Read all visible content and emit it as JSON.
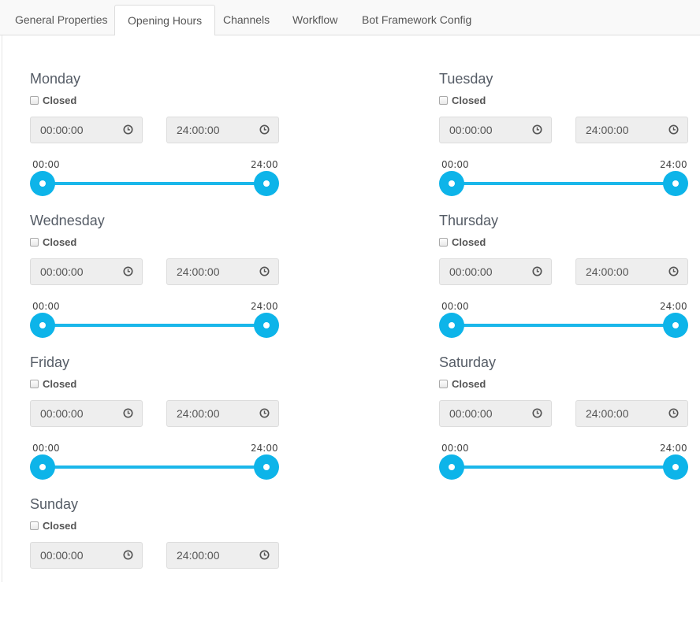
{
  "tabs": [
    {
      "label": "General Properties",
      "active": false
    },
    {
      "label": "Opening Hours",
      "active": true
    },
    {
      "label": "Channels",
      "active": false
    },
    {
      "label": "Workflow",
      "active": false
    },
    {
      "label": "Bot Framework Config",
      "active": false
    }
  ],
  "colors": {
    "accent": "#0db4e9",
    "input_bg": "#eeeeee"
  },
  "icons": {
    "time": "clock-icon"
  },
  "days": [
    {
      "name": "Monday",
      "closed_label": "Closed",
      "closed": false,
      "open": "00:00:00",
      "close": "24:00:00",
      "slider_min_label": "00:00",
      "slider_max_label": "24:00",
      "range": [
        0,
        24
      ]
    },
    {
      "name": "Tuesday",
      "closed_label": "Closed",
      "closed": false,
      "open": "00:00:00",
      "close": "24:00:00",
      "slider_min_label": "00:00",
      "slider_max_label": "24:00",
      "range": [
        0,
        24
      ]
    },
    {
      "name": "Wednesday",
      "closed_label": "Closed",
      "closed": false,
      "open": "00:00:00",
      "close": "24:00:00",
      "slider_min_label": "00:00",
      "slider_max_label": "24:00",
      "range": [
        0,
        24
      ]
    },
    {
      "name": "Thursday",
      "closed_label": "Closed",
      "closed": false,
      "open": "00:00:00",
      "close": "24:00:00",
      "slider_min_label": "00:00",
      "slider_max_label": "24:00",
      "range": [
        0,
        24
      ]
    },
    {
      "name": "Friday",
      "closed_label": "Closed",
      "closed": false,
      "open": "00:00:00",
      "close": "24:00:00",
      "slider_min_label": "00:00",
      "slider_max_label": "24:00",
      "range": [
        0,
        24
      ]
    },
    {
      "name": "Saturday",
      "closed_label": "Closed",
      "closed": false,
      "open": "00:00:00",
      "close": "24:00:00",
      "slider_min_label": "00:00",
      "slider_max_label": "24:00",
      "range": [
        0,
        24
      ]
    },
    {
      "name": "Sunday",
      "closed_label": "Closed",
      "closed": false,
      "open": "00:00:00",
      "close": "24:00:00"
    }
  ]
}
